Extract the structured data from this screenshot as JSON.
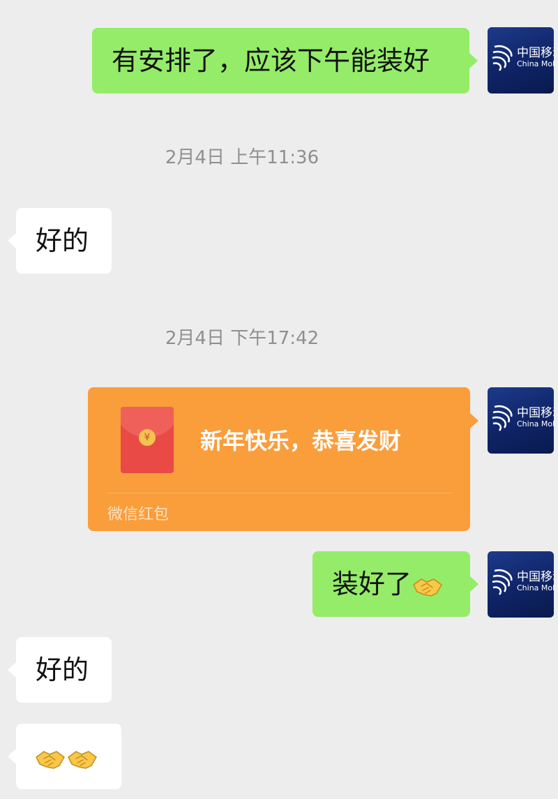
{
  "messages": {
    "m1": {
      "text": "有安排了，应该下午能装好",
      "side": "sent"
    },
    "t1": {
      "text": "2月4日 上午11:36"
    },
    "m2": {
      "text": "好的",
      "side": "received"
    },
    "t2": {
      "text": "2月4日 下午17:42"
    },
    "red_packet": {
      "title": "新年快乐，恭喜发财",
      "label": "微信红包",
      "coin_symbol": "¥"
    },
    "m3": {
      "text": "装好了",
      "emoji": "handshake-emoji",
      "side": "sent"
    },
    "m4": {
      "text": "好的",
      "side": "received"
    },
    "m5": {
      "emojis": [
        "handshake-emoji",
        "handshake-emoji"
      ],
      "side": "received"
    }
  },
  "avatar": {
    "brand_cn": "中国移动",
    "brand_en": "China Mobile"
  },
  "colors": {
    "background": "#ededed",
    "sent_bubble": "#95ec69",
    "received_bubble": "#ffffff",
    "red_packet": "#fa9d3b",
    "timestamp": "#8f8f8f"
  }
}
